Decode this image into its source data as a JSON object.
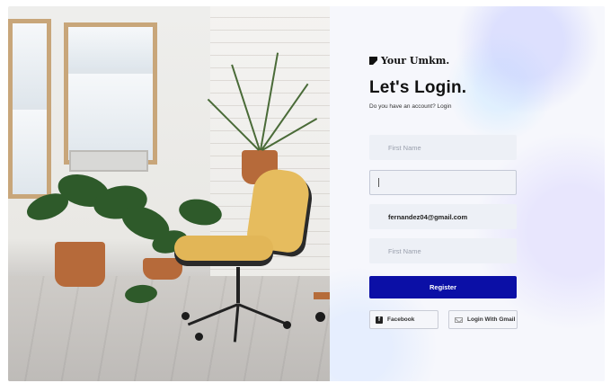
{
  "brand": {
    "name": "Your Umkm.",
    "icon": "brand-logo-icon"
  },
  "login": {
    "title": "Let's Login.",
    "subtitle": "Do you have an account? Login"
  },
  "form": {
    "first_name_placeholder": "First Name",
    "second_field_value": "",
    "email_value": "fernandez04@gmail.com",
    "last_field_placeholder": "First Name"
  },
  "buttons": {
    "register_label": "Register",
    "facebook_label": "Facebook",
    "gmail_label": "Login With Gmail"
  },
  "colors": {
    "accent": "#0b0fa6",
    "field_bg": "#edf0f6",
    "chair": "#e2b657"
  },
  "icons": {
    "facebook": "facebook-icon",
    "gmail": "mail-icon"
  }
}
